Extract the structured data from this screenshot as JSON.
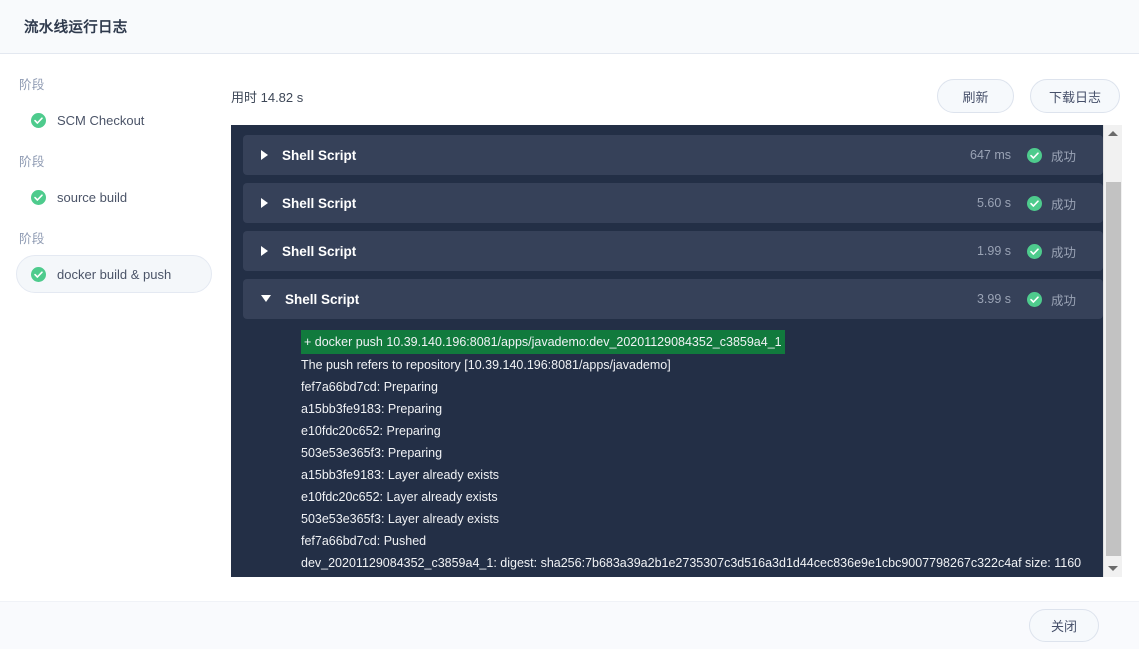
{
  "header": {
    "title": "流水线运行日志"
  },
  "sidebar": {
    "groups": [
      {
        "label": "阶段",
        "item": {
          "label": "SCM Checkout",
          "status_icon": "check-circle-icon",
          "selected": false
        }
      },
      {
        "label": "阶段",
        "item": {
          "label": "source build",
          "status_icon": "check-circle-icon",
          "selected": false
        }
      },
      {
        "label": "阶段",
        "item": {
          "label": "docker build & push",
          "status_icon": "check-circle-icon",
          "selected": true
        }
      }
    ]
  },
  "toolbar": {
    "elapsed_label": "用时 14.82 s",
    "refresh_label": "刷新",
    "download_label": "下载日志"
  },
  "console": {
    "steps": [
      {
        "name": "Shell Script",
        "duration": "647 ms",
        "status": "成功",
        "expanded": false,
        "toggle_icon": "chevron-right-icon"
      },
      {
        "name": "Shell Script",
        "duration": "5.60 s",
        "status": "成功",
        "expanded": false,
        "toggle_icon": "chevron-right-icon"
      },
      {
        "name": "Shell Script",
        "duration": "1.99 s",
        "status": "成功",
        "expanded": false,
        "toggle_icon": "chevron-right-icon"
      },
      {
        "name": "Shell Script",
        "duration": "3.99 s",
        "status": "成功",
        "expanded": true,
        "toggle_icon": "chevron-down-icon"
      }
    ],
    "output_lines": [
      "+ docker push 10.39.140.196:8081/apps/javademo:dev_20201129084352_c3859a4_1",
      "The push refers to repository [10.39.140.196:8081/apps/javademo]",
      "fef7a66bd7cd: Preparing",
      "a15bb3fe9183: Preparing",
      "e10fdc20c652: Preparing",
      "503e53e365f3: Preparing",
      "a15bb3fe9183: Layer already exists",
      "e10fdc20c652: Layer already exists",
      "503e53e365f3: Layer already exists",
      "fef7a66bd7cd: Pushed",
      "dev_20201129084352_c3859a4_1: digest: sha256:7b683a39a2b1e2735307c3d516a3d1d44cec836e9e1cbc9007798267c322c4af size: 1160"
    ]
  },
  "footer": {
    "close_label": "关闭"
  },
  "colors": {
    "panel_bg": "#232f46",
    "step_row_bg": "#364159",
    "success_green": "#4ecb8d",
    "command_highlight": "#117a3d",
    "header_bg": "#f8fafc"
  }
}
